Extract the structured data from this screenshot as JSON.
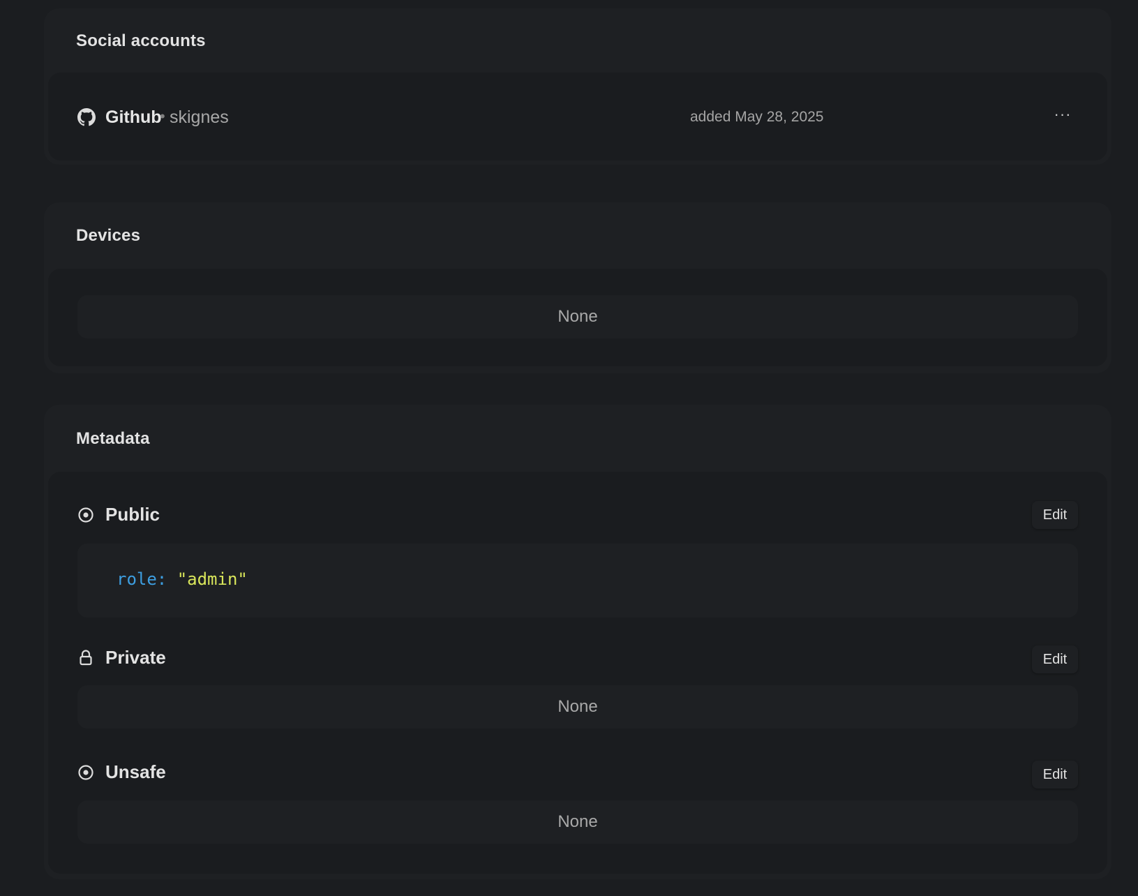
{
  "social_accounts": {
    "title": "Social accounts",
    "accounts": [
      {
        "icon": "github-icon",
        "provider": "Github",
        "separator": "•",
        "username": "skignes",
        "added": "added May 28, 2025",
        "menu_label": "···"
      }
    ]
  },
  "devices": {
    "title": "Devices",
    "empty_text": "None"
  },
  "metadata": {
    "title": "Metadata",
    "public": {
      "label": "Public",
      "icon": "eye-icon",
      "edit_label": "Edit",
      "entries": [
        {
          "key": "role:",
          "value": "\"admin\""
        }
      ]
    },
    "private": {
      "label": "Private",
      "icon": "lock-icon",
      "edit_label": "Edit",
      "empty_text": "None"
    },
    "unsafe": {
      "label": "Unsafe",
      "icon": "eye-icon",
      "edit_label": "Edit",
      "empty_text": "None"
    }
  },
  "colors": {
    "background": "#1b1d20",
    "card": "#1e2023",
    "inner_card": "#1a1c1f",
    "code_key": "#3d9ee0",
    "code_value": "#d9e65b"
  }
}
